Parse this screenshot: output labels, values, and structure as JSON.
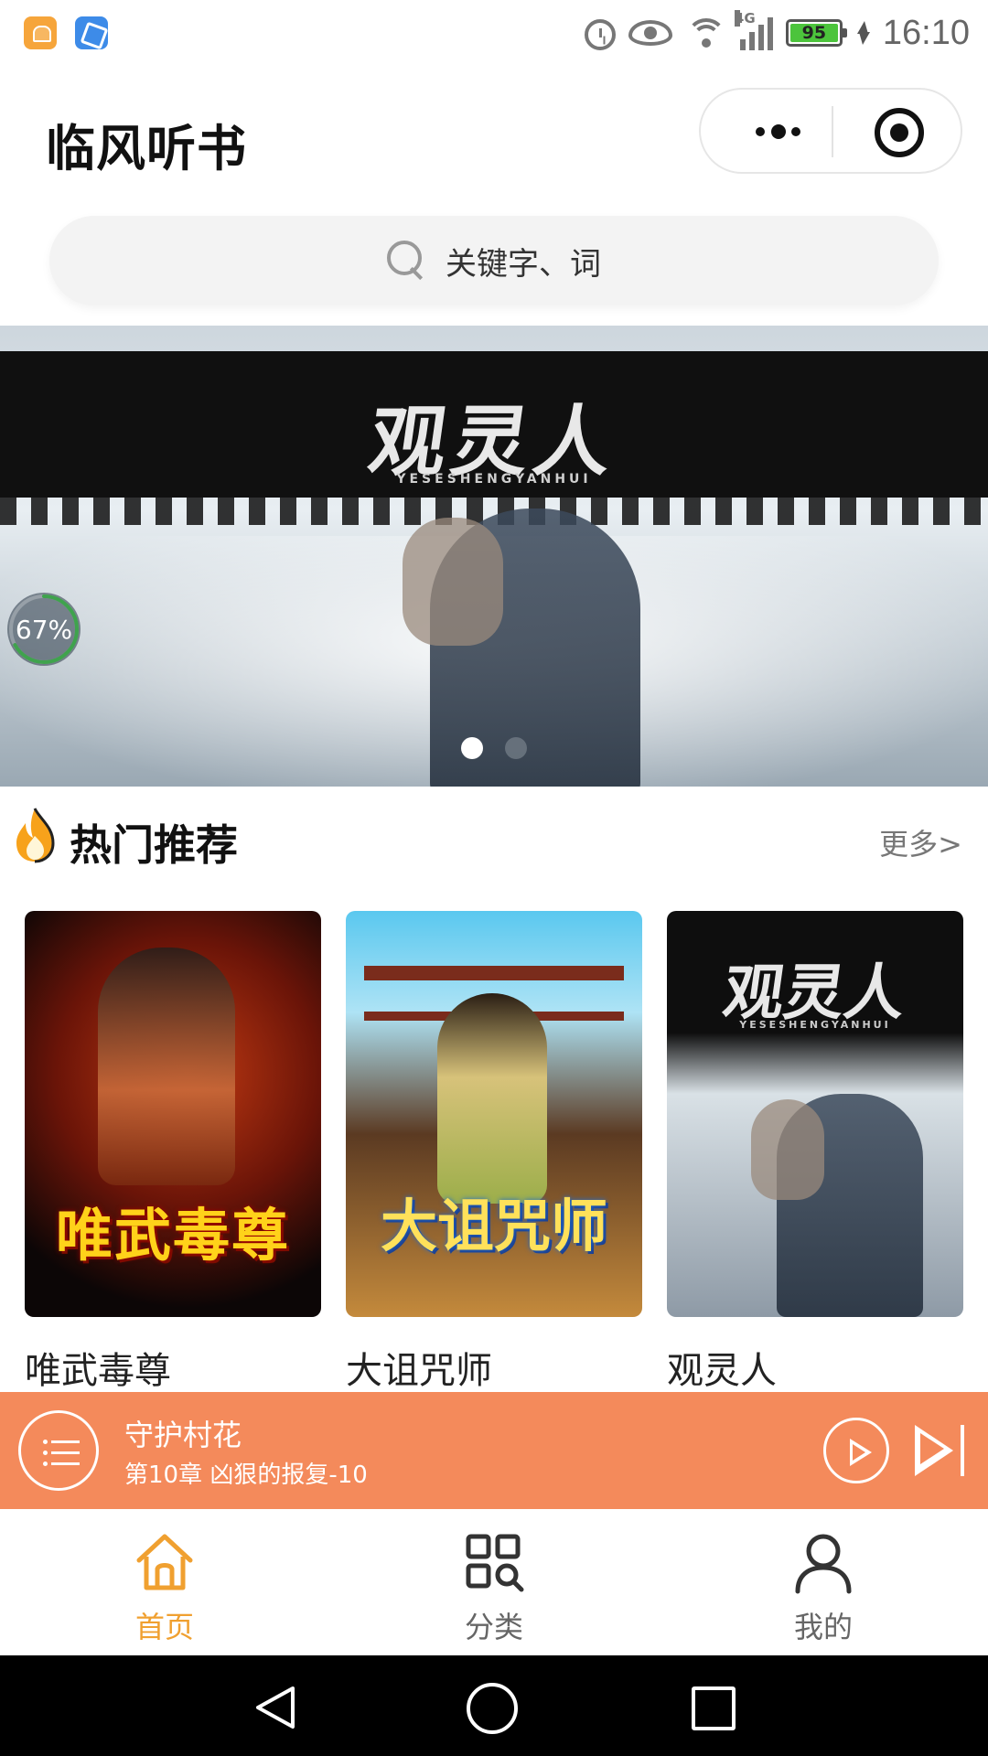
{
  "status_bar": {
    "battery": "95",
    "network": "4G",
    "time": "16:10"
  },
  "header": {
    "title": "临风听书",
    "menu_icon": "more-dots-icon",
    "close_icon": "target-icon"
  },
  "search": {
    "placeholder": "关键字、词",
    "icon": "search-icon"
  },
  "banner": {
    "title": "观灵人",
    "subtitle": "YESESHENGYANHUI",
    "progress_label": "67%",
    "progress": 0.67,
    "slide_count": 2,
    "active_slide": 1
  },
  "section": {
    "icon": "fire-icon",
    "title": "热门推荐",
    "more_label": "更多>"
  },
  "books": [
    {
      "name": "唯武毒尊",
      "cover_text": "唯武毒尊"
    },
    {
      "name": "大诅咒师",
      "cover_text": "大诅咒师"
    },
    {
      "name": "观灵人",
      "cover_text": "观灵人",
      "cover_subtext": "YESESHENGYANHUI"
    }
  ],
  "player": {
    "title": "守护村花",
    "chapter": "第10章 凶狠的报复-10",
    "background": "#f48a5b"
  },
  "tabs": [
    {
      "label": "首页",
      "icon": "home-icon",
      "active": true
    },
    {
      "label": "分类",
      "icon": "category-search-icon",
      "active": false
    },
    {
      "label": "我的",
      "icon": "user-icon",
      "active": false
    }
  ],
  "colors": {
    "accent": "#f0a030",
    "player": "#f48a5b"
  }
}
